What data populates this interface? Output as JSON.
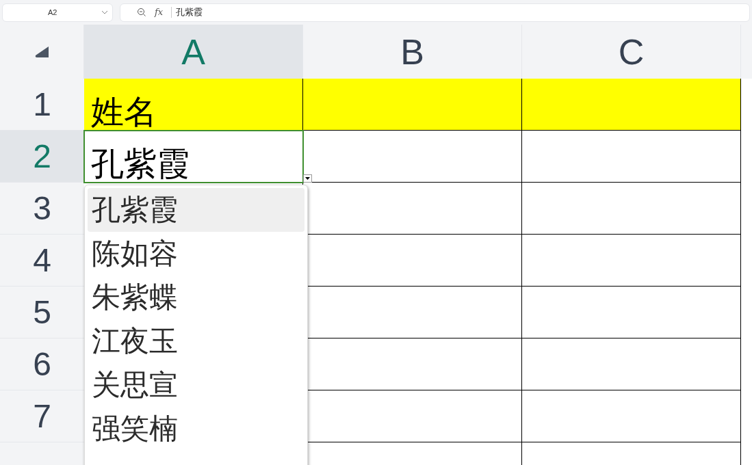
{
  "name_box": {
    "value": "A2"
  },
  "formula_bar": {
    "function_label": "fx",
    "value": "孔紫霞"
  },
  "columns": [
    {
      "label": "A",
      "selected": true
    },
    {
      "label": "B",
      "selected": false
    },
    {
      "label": "C",
      "selected": false
    }
  ],
  "rows": [
    {
      "label": "1",
      "selected": false,
      "cells": [
        "姓名",
        "",
        ""
      ],
      "highlight": true
    },
    {
      "label": "2",
      "selected": true,
      "cells": [
        "孔紫霞",
        "",
        ""
      ],
      "highlight": false
    },
    {
      "label": "3",
      "selected": false,
      "cells": [
        "",
        "",
        ""
      ],
      "highlight": false
    },
    {
      "label": "4",
      "selected": false,
      "cells": [
        "",
        "",
        ""
      ],
      "highlight": false
    },
    {
      "label": "5",
      "selected": false,
      "cells": [
        "",
        "",
        ""
      ],
      "highlight": false
    },
    {
      "label": "6",
      "selected": false,
      "cells": [
        "",
        "",
        ""
      ],
      "highlight": false
    },
    {
      "label": "7",
      "selected": false,
      "cells": [
        "",
        "",
        ""
      ],
      "highlight": false
    }
  ],
  "dropdown": {
    "items": [
      {
        "label": "孔紫霞",
        "selected": true
      },
      {
        "label": "陈如容",
        "selected": false
      },
      {
        "label": "朱紫蝶",
        "selected": false
      },
      {
        "label": "江夜玉",
        "selected": false
      },
      {
        "label": "关思宣",
        "selected": false
      },
      {
        "label": "强笑楠",
        "selected": false
      }
    ]
  }
}
